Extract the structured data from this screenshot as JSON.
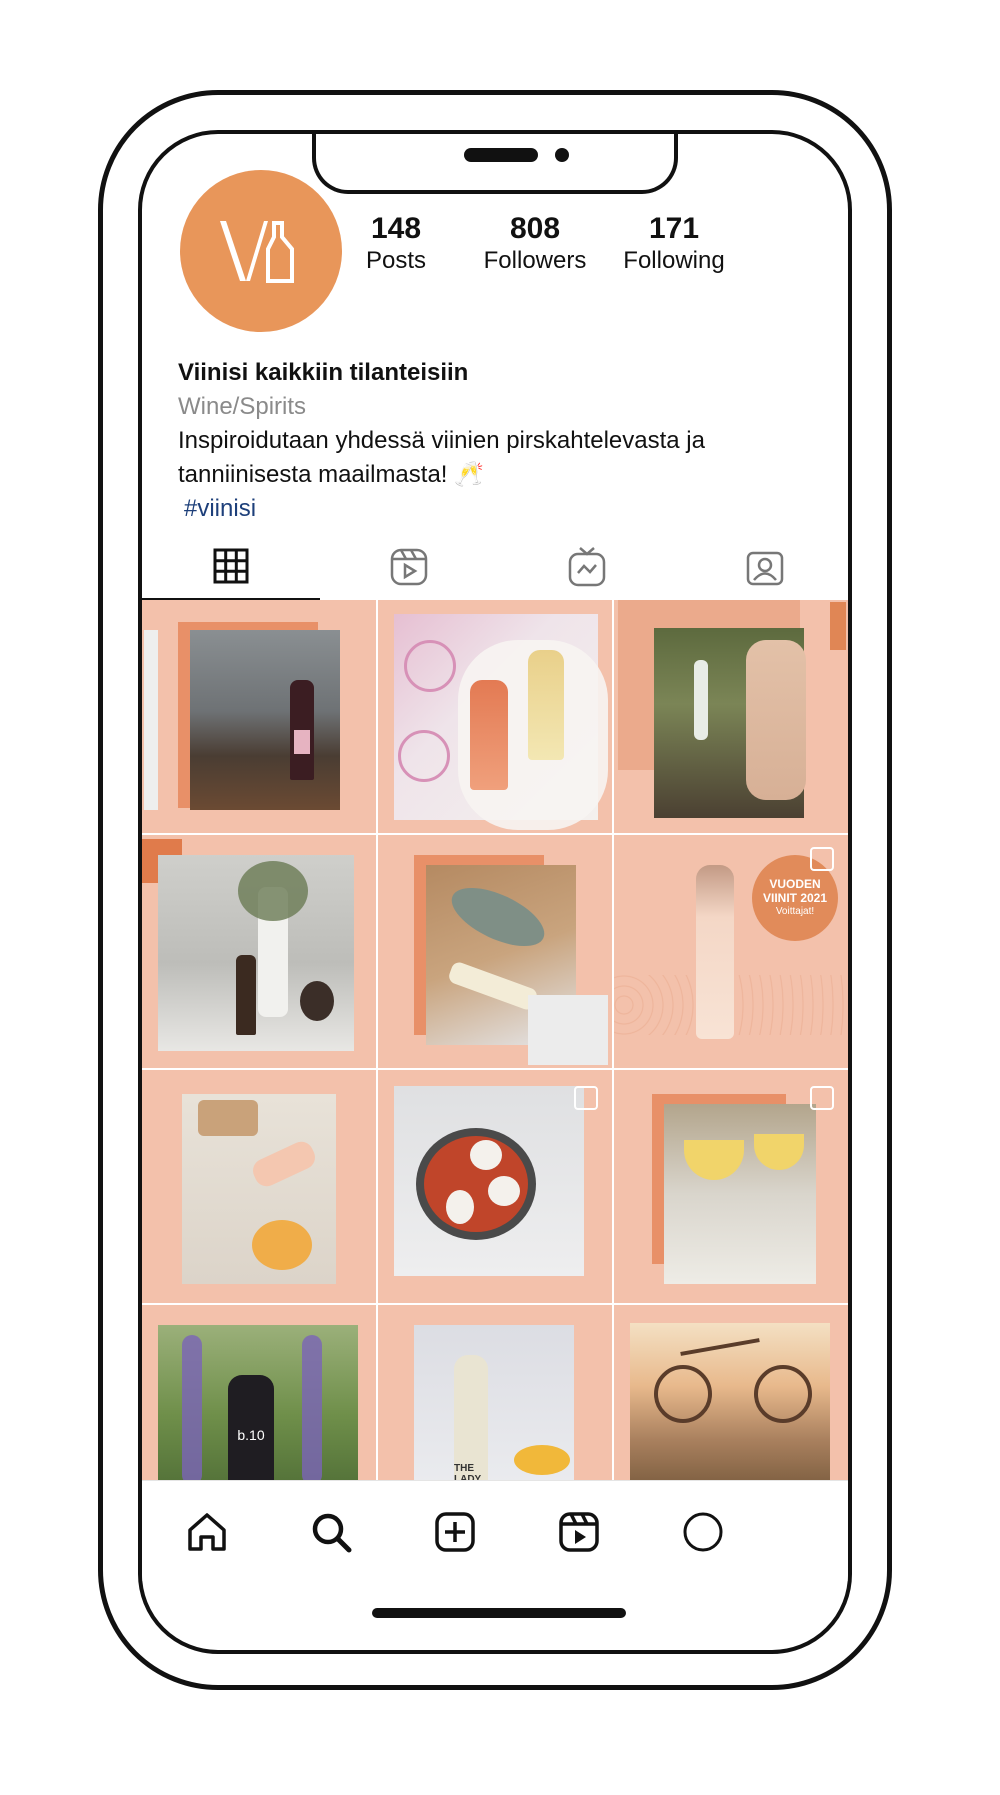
{
  "profile": {
    "avatar_icon": "vinisi-logo-icon",
    "brand_color": "#e8965a",
    "stats": {
      "posts": {
        "value": "148",
        "label": "Posts"
      },
      "followers": {
        "value": "808",
        "label": "Followers"
      },
      "following": {
        "value": "171",
        "label": "Following"
      }
    },
    "name": "Viinisi kaikkiin tilanteisiin",
    "category": "Wine/Spirits",
    "bio_line1": "Inspiroidutaan yhdessä viinien pirskahtelevasta ja",
    "bio_line2": "tanniinisesta maailmasta! 🥂",
    "hashtag": "#viinisi"
  },
  "tabs": [
    {
      "icon": "grid-icon",
      "active": true
    },
    {
      "icon": "reels-icon",
      "active": false
    },
    {
      "icon": "igtv-icon",
      "active": false
    },
    {
      "icon": "tagged-icon",
      "active": false
    }
  ],
  "posts": [
    {
      "subject": "red wine with grilled meat"
    },
    {
      "subject": "Freixenet rosé and white on ice"
    },
    {
      "subject": "woman with sparkling wine"
    },
    {
      "subject": "red wine glasses with flowers"
    },
    {
      "subject": "fish and white wine"
    },
    {
      "subject": "rosé sparkling bottle",
      "badge_line1": "VUODEN",
      "badge_line2": "VIINIT 2021",
      "badge_line3": "Voittajat!"
    },
    {
      "subject": "picnic with rosé"
    },
    {
      "subject": "pan with tomatoes and burrata"
    },
    {
      "subject": "cocktails with lemon"
    },
    {
      "subject": "b.io wine with lupines",
      "bottle_label": "b.10"
    },
    {
      "subject": "The Lady white wine",
      "bottle_label": "THE LADY"
    },
    {
      "subject": "bicycle by the sea"
    }
  ],
  "bottom_nav": [
    "home-icon",
    "search-icon",
    "new-post-icon",
    "reels-icon",
    "profile-icon"
  ]
}
